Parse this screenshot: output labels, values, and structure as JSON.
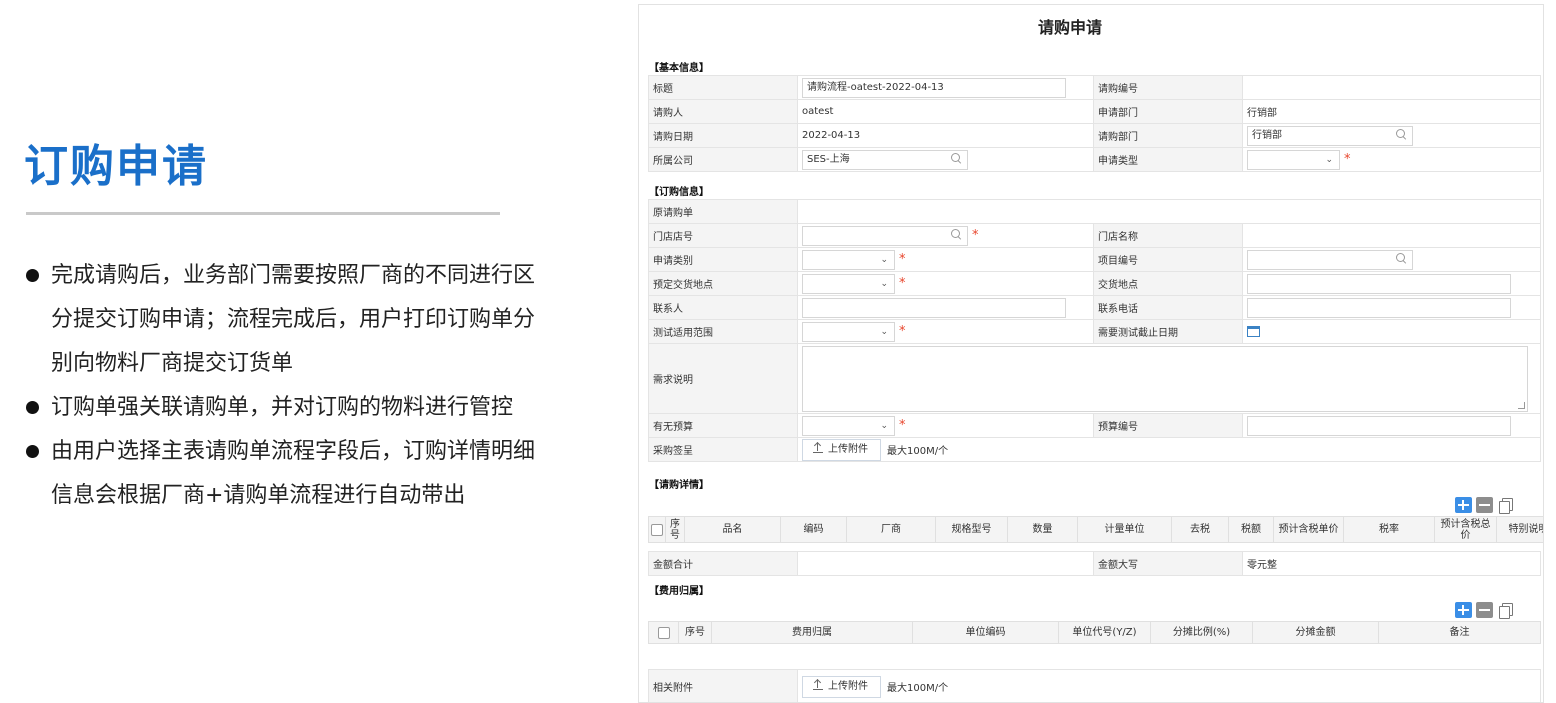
{
  "slide": {
    "title": "订购申请",
    "bullets": [
      "完成请购后，业务部门需要按照厂商的不同进行区分提交订购申请；流程完成后，用户打印订购单分别向物料厂商提交订货单",
      "订购单强关联请购单，并对订购的物料进行管控",
      "由用户选择主表请购单流程字段后，订购详情明细信息会根据厂商+请购单流程进行自动带出"
    ]
  },
  "form": {
    "title": "请购申请",
    "sections": {
      "basic": "【基本信息】",
      "order": "【订购信息】",
      "detail": "【请购详情】",
      "cost": "【费用归属】"
    },
    "basic": {
      "title_label": "标题",
      "title_value": "请购流程-oatest-2022-04-13",
      "no_label": "请购编号",
      "applicant_label": "请购人",
      "applicant_value": "oatest",
      "apply_dept_label": "申请部门",
      "apply_dept_value": "行销部",
      "date_label": "请购日期",
      "date_value": "2022-04-13",
      "purchase_dept_label": "请购部门",
      "purchase_dept_value": "行销部",
      "company_label": "所属公司",
      "company_value": "SES-上海",
      "apply_type_label": "申请类型"
    },
    "order": {
      "orig_label": "原请购单",
      "store_no_label": "门店店号",
      "store_name_label": "门店名称",
      "category_label": "申请类别",
      "project_no_label": "项目编号",
      "delivery_plan_label": "预定交货地点",
      "delivery_label": "交货地点",
      "contact_label": "联系人",
      "phone_label": "联系电话",
      "test_scope_label": "测试适用范围",
      "test_deadline_label": "需要测试截止日期",
      "desc_label": "需求说明",
      "budget_label": "有无预算",
      "budget_no_label": "预算编号",
      "sign_label": "采购签呈",
      "upload_label": "上传附件",
      "upload_hint": "最大100M/个"
    },
    "detail_headers": [
      "序号",
      "品名",
      "编码",
      "厂商",
      "规格型号",
      "数量",
      "计量单位",
      "去税",
      "税额",
      "预计含税单价",
      "税率",
      "预计含税总价",
      "特别说明"
    ],
    "totals": {
      "sum_label": "金额合计",
      "upper_label": "金额大写",
      "upper_value": "零元整"
    },
    "cost_headers": [
      "序号",
      "费用归属",
      "单位编码",
      "单位代号(Y/Z)",
      "分摊比例(%)",
      "分摊金额",
      "备注"
    ],
    "attach": {
      "label": "相关附件",
      "upload_label": "上传附件",
      "hint": "最大100M/个"
    },
    "required_mark": "*"
  }
}
